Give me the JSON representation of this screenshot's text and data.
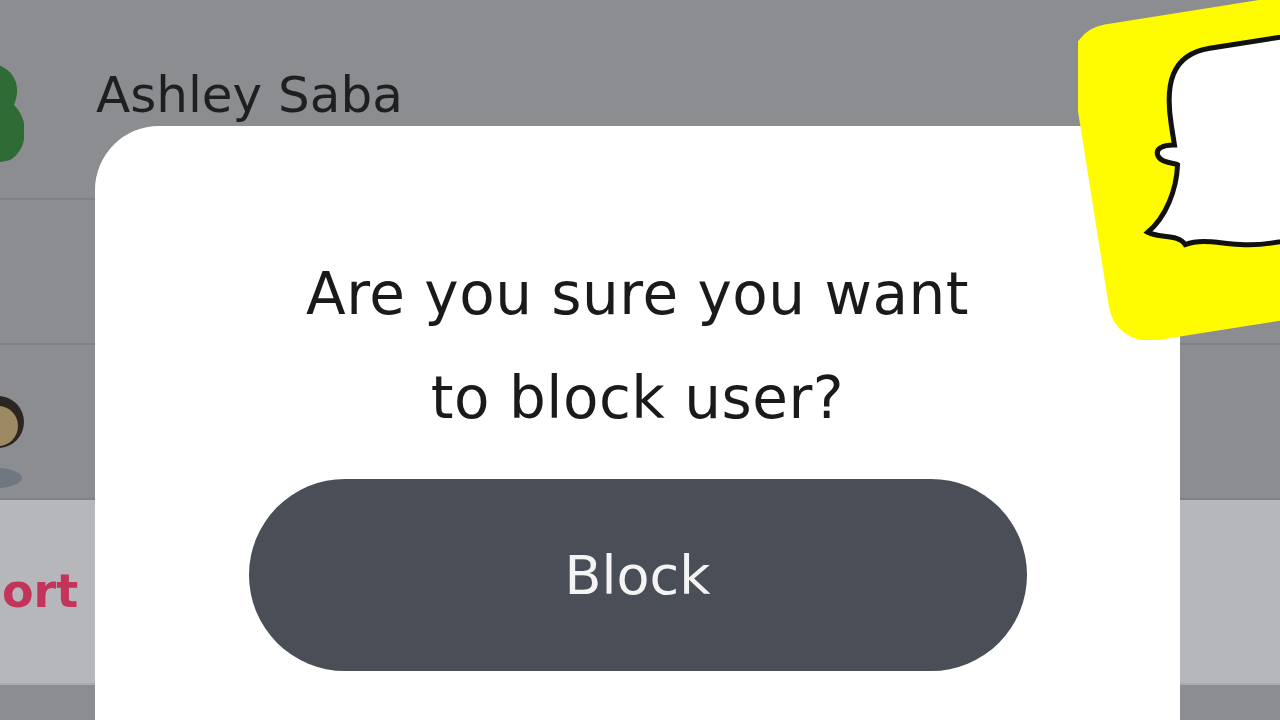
{
  "profile": {
    "name": "Ashley Saba"
  },
  "list": {
    "action_label": "ort"
  },
  "dialog": {
    "title_lines": [
      "Are you sure you want",
      "to block user?"
    ],
    "button": "Block"
  }
}
